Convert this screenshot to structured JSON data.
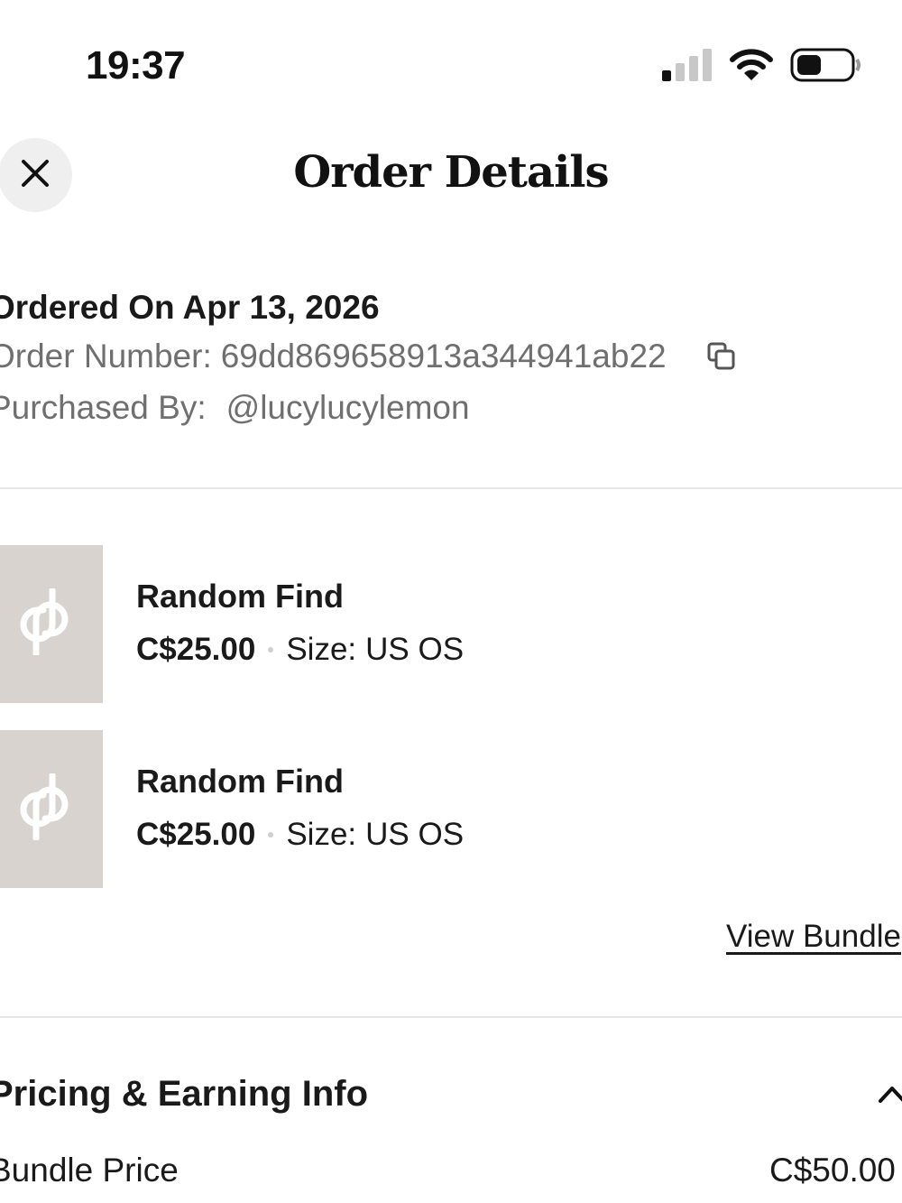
{
  "status_bar": {
    "time": "19:37",
    "icons": [
      "cellular-signal-icon",
      "wifi-icon",
      "battery-icon"
    ]
  },
  "header": {
    "title": "Order Details",
    "close_icon": "close-icon"
  },
  "order": {
    "ordered_on": "Ordered On Apr 13, 2026",
    "order_number_label": "Order Number:",
    "order_number": "69dd869658913a344941ab22",
    "purchased_by_label": "Purchased By:",
    "purchased_by": "@lucylucylemon",
    "copy_icon": "copy-icon"
  },
  "items": [
    {
      "title": "Random Find",
      "price": "C$25.00",
      "size_label": "Size:",
      "size": "US OS",
      "thumbnail_icon": "poshmark-logo-icon"
    },
    {
      "title": "Random Find",
      "price": "C$25.00",
      "size_label": "Size:",
      "size": "US OS",
      "thumbnail_icon": "poshmark-logo-icon"
    }
  ],
  "view_bundle": "View Bundle",
  "pricing": {
    "title": "Pricing & Earning Info",
    "toggle_icon": "chevron-up-icon",
    "rows": [
      {
        "label": "Bundle Price",
        "value": "C$50.00"
      }
    ]
  },
  "colors": {
    "background": "#ffffff",
    "text": "#1a1a1a",
    "muted_text": "#6f6f6f",
    "thumbnail_bg": "#d9d3cf",
    "divider": "#e6e6e6",
    "close_button_bg": "#efefef"
  }
}
